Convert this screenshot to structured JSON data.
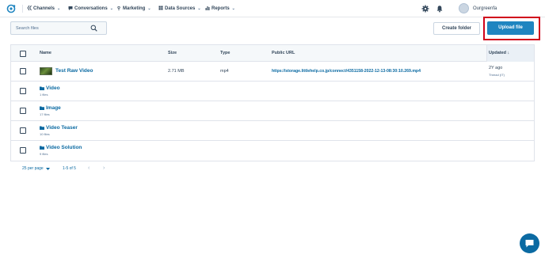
{
  "colors": {
    "accent": "#1f85c0",
    "link": "#0b6aa2",
    "text": "#33475b",
    "highlight": "#d0021b"
  },
  "nav": {
    "logo_icon": "sprocket-logo-icon",
    "items": [
      {
        "label": "Channels",
        "icon": "double-chevron-icon"
      },
      {
        "label": "Conversations",
        "icon": "chat-icon"
      },
      {
        "label": "Marketing",
        "icon": "broadcast-icon"
      },
      {
        "label": "Data Sources",
        "icon": "grid-icon"
      },
      {
        "label": "Reports",
        "icon": "bar-chart-icon"
      }
    ],
    "user_name": "Ourgreenfa"
  },
  "toolbar": {
    "search_placeholder": "Search files",
    "create_folder_label": "Create folder",
    "upload_file_label": "Upload file"
  },
  "table": {
    "columns": {
      "name": "Name",
      "size": "Size",
      "type": "Type",
      "public_url": "Public URL",
      "updated": "Updated ↓"
    },
    "file_rows": [
      {
        "name": "Test Raw Video",
        "size": "2.71 MB",
        "type": "mp4",
        "url": "https://storage.littlehelp.co.jp/connect/4351158-2022-12-13-08:30:10.269.mp4",
        "updated": "2Y ago",
        "updated_day": "Thread (IT)"
      }
    ],
    "folder_rows": [
      {
        "name": "Video",
        "count": "1 files"
      },
      {
        "name": "Image",
        "count": "17 files"
      },
      {
        "name": "Video Teaser",
        "count": "10 files"
      },
      {
        "name": "Video Solution",
        "count": "9 files"
      }
    ]
  },
  "pagination": {
    "per_page": "25 per page",
    "range": "1-5 of 5",
    "prev": "‹",
    "next": "›"
  },
  "chat": {
    "icon": "chat-bubble-icon"
  }
}
